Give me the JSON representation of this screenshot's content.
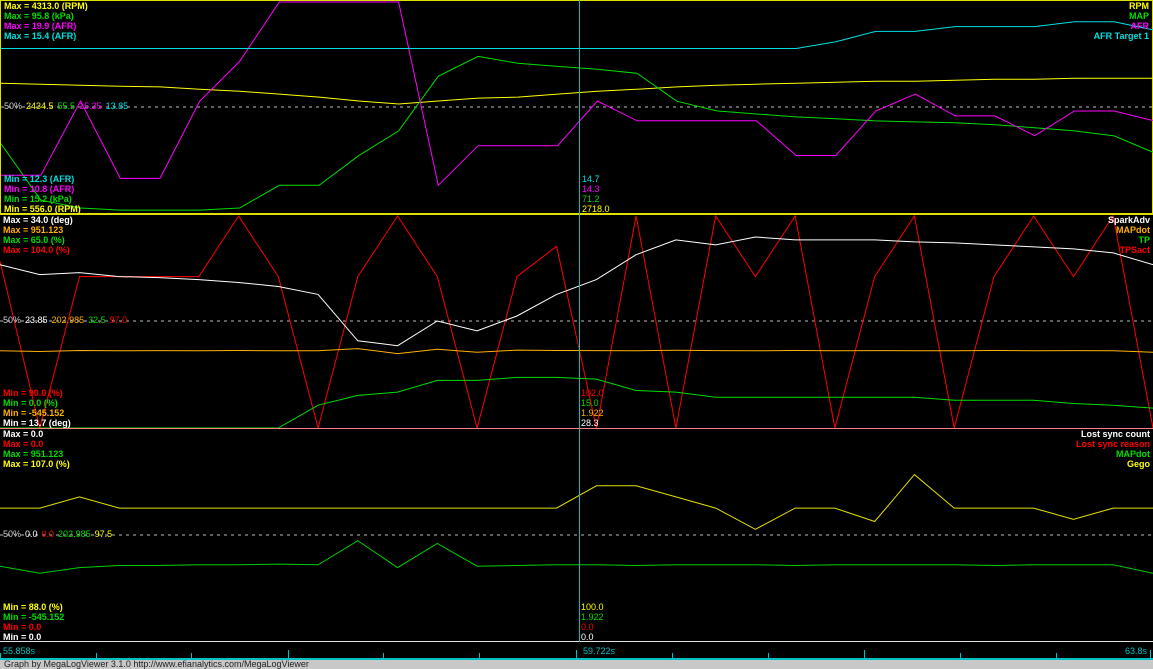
{
  "colors": {
    "yellow": "#ffff00",
    "green": "#00dd00",
    "magenta": "#ff00ff",
    "cyan": "#00e0e0",
    "white": "#ffffff",
    "orange": "#ffb000",
    "red": "#ff0000",
    "gego": "#e0e000"
  },
  "time_axis": {
    "start": "55.858s",
    "cursor": "59.722s",
    "end": "63.8s",
    "range": [
      55.858,
      63.8
    ]
  },
  "footer": "Graph by MegaLogViewer 3.1.0 http://www.efianalytics.com/MegaLogViewer",
  "panels": [
    {
      "max_labels": [
        "Max = 4313.0 (RPM)",
        "Max = 95.8 (kPa)",
        "Max = 19.9 (AFR)",
        "Max = 15.4 (AFR)"
      ],
      "min_labels": [
        "Min = 12.3 (AFR)",
        "Min = 10.8 (AFR)",
        "Min = 15.2 (kPa)",
        "Min = 556.0 (RPM)"
      ],
      "legend": [
        "RPM",
        "MAP",
        "AFR",
        "AFR Target 1"
      ],
      "mid_values": [
        "50%",
        "2434.5",
        "55.5",
        "15.35",
        "13.85"
      ],
      "cursor_values": [
        "14.7",
        "14.3",
        "71.2",
        "2718.0"
      ],
      "series": [
        {
          "name": "RPM",
          "color": "#ffff00",
          "range": [
            556,
            4313
          ],
          "values": [
            2874,
            2856,
            2838,
            2820,
            2809,
            2768,
            2733,
            2680,
            2628,
            2558,
            2505,
            2558,
            2610,
            2628,
            2680,
            2733,
            2768,
            2809,
            2838,
            2856,
            2874,
            2891,
            2909,
            2909,
            2926,
            2944,
            2944,
            2961,
            2961,
            2961
          ]
        },
        {
          "name": "MAP",
          "color": "#00dd00",
          "range": [
            15.2,
            95.8
          ],
          "values": [
            41.9,
            20.5,
            17.5,
            16.7,
            16.7,
            16.7,
            17.5,
            26.1,
            26.1,
            37.4,
            46.8,
            67.6,
            75.1,
            72.5,
            71.3,
            70.2,
            68.7,
            58.1,
            54.4,
            53.2,
            52.1,
            51.4,
            50.6,
            50.2,
            49.9,
            49.1,
            48.0,
            46.8,
            44.9,
            38.5
          ]
        },
        {
          "name": "AFR",
          "color": "#ff00ff",
          "range": [
            10.8,
            19.9
          ],
          "values": [
            12.46,
            12.46,
            15.65,
            12.33,
            12.33,
            15.65,
            17.35,
            19.9,
            19.9,
            19.9,
            19.9,
            12.03,
            13.73,
            13.73,
            13.73,
            15.65,
            14.8,
            14.8,
            14.8,
            14.8,
            13.31,
            13.31,
            15.22,
            15.95,
            15.01,
            15.01,
            14.16,
            15.22,
            15.22,
            14.8
          ]
        },
        {
          "name": "AFR Target 1",
          "color": "#00e0e0",
          "range": [
            12.3,
            15.4
          ],
          "values": [
            14.72,
            14.72,
            14.72,
            14.72,
            14.72,
            14.72,
            14.72,
            14.72,
            14.72,
            14.72,
            14.72,
            14.72,
            14.72,
            14.72,
            14.72,
            14.72,
            14.72,
            14.72,
            14.72,
            14.72,
            14.72,
            14.82,
            14.97,
            14.97,
            15.04,
            15.04,
            15.04,
            15.11,
            15.11,
            14.99
          ]
        }
      ]
    },
    {
      "max_labels": [
        "Max = 34.0 (deg)",
        "Max = 951.123",
        "Max = 65.0 (%)",
        "Max = 104.0 (%)"
      ],
      "min_labels": [
        "Min = 90.0 (%)",
        "Min = 0.0 (%)",
        "Min = -545.152",
        "Min = 13.7 (deg)"
      ],
      "legend": [
        "SparkAdv",
        "MAPdot",
        "TP",
        "TPSact"
      ],
      "mid_values": [
        "50%",
        "23.85",
        "202.985",
        "32.5",
        "97.0"
      ],
      "cursor_values": [
        "102.0",
        "15.0",
        "1.922",
        "28.3"
      ],
      "series": [
        {
          "name": "TPSact",
          "color": "#ff0000",
          "range": [
            90,
            104
          ],
          "values": [
            101,
            90,
            100,
            100,
            100,
            100,
            104,
            100,
            90,
            100,
            104,
            100,
            90,
            100,
            102,
            90,
            104,
            90,
            104,
            100,
            104,
            90,
            100,
            104,
            90,
            100,
            104,
            100,
            104,
            90
          ]
        },
        {
          "name": "TP",
          "color": "#00dd00",
          "range": [
            0,
            65
          ],
          "values": [
            0,
            0,
            0,
            0,
            0,
            0,
            0,
            0,
            7.0,
            10,
            11,
            14.6,
            14.6,
            15.5,
            15.5,
            15.0,
            11.5,
            11,
            9.4,
            9.4,
            9.4,
            9.4,
            9.4,
            9.4,
            8.5,
            8.5,
            8.5,
            7.5,
            7.0,
            6.1
          ]
        },
        {
          "name": "MAPdot",
          "color": "#ffb000",
          "range": [
            -545.152,
            951.123
          ],
          "values": [
            0,
            -5,
            2,
            0,
            1,
            0,
            2,
            0,
            0,
            15,
            -20,
            10,
            -10,
            5,
            2,
            1,
            0,
            3,
            1,
            0,
            2,
            0,
            1,
            0,
            0,
            2,
            0,
            1,
            0,
            -10
          ]
        },
        {
          "name": "SparkAdv",
          "color": "#ffffff",
          "range": [
            13.7,
            34
          ],
          "values": [
            29.34,
            28.39,
            28.58,
            28.2,
            28.1,
            27.91,
            27.63,
            27.25,
            26.49,
            22.05,
            21.58,
            23.95,
            23.0,
            24.42,
            26.49,
            27.91,
            30.29,
            31.71,
            31.23,
            31.99,
            31.71,
            31.71,
            31.71,
            31.52,
            31.42,
            31.23,
            31.04,
            30.85,
            30.47,
            29.34
          ]
        }
      ]
    },
    {
      "max_labels": [
        "Max = 0.0",
        "Max = 0.0",
        "Max = 951.123",
        "Max = 107.0 (%)"
      ],
      "min_labels": [
        "Min = 88.0 (%)",
        "Min = -545.152",
        "Min = 0.0",
        "Min = 0.0"
      ],
      "legend": [
        "Lost sync count",
        "Lost sync reason",
        "MAPdot",
        "Gego"
      ],
      "mid_values": [
        "50%",
        "0.0",
        "0.0",
        "202.985",
        "97.5"
      ],
      "cursor_values": [
        "100.0",
        "1.922",
        "0.0",
        "0.0"
      ],
      "series": [
        {
          "name": "Gego",
          "color": "#e0e000",
          "range": [
            88,
            107
          ],
          "values": [
            100,
            100,
            101,
            100,
            100,
            100,
            100,
            100,
            100,
            100,
            100,
            100,
            100,
            100,
            100,
            102,
            102,
            101,
            100,
            98.1,
            100,
            100,
            98.8,
            103,
            100,
            100,
            100,
            99,
            100,
            100
          ]
        },
        {
          "name": "MAPdot",
          "color": "#00cc00",
          "range": [
            -545.152,
            951.123
          ],
          "values": [
            -10,
            -60,
            -20,
            -5,
            -5,
            0,
            0,
            5,
            0,
            170,
            -20,
            150,
            -10,
            -5,
            0,
            0,
            -5,
            0,
            0,
            0,
            -5,
            0,
            0,
            0,
            0,
            -5,
            0,
            0,
            0,
            -60
          ]
        }
      ]
    }
  ]
}
